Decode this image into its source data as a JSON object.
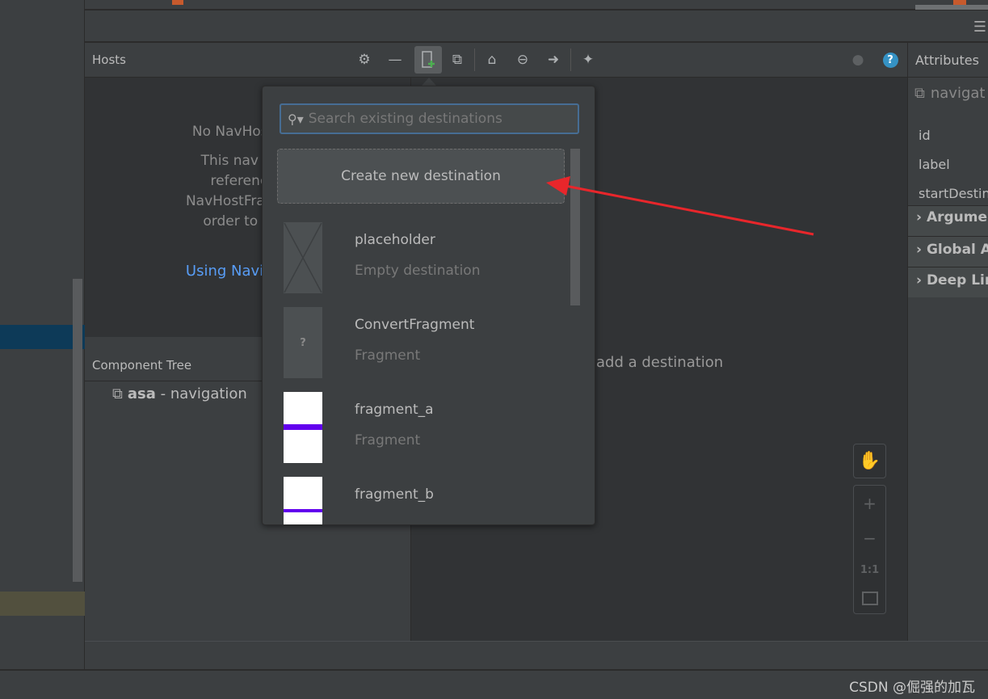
{
  "hosts_panel": {
    "title": "Hosts",
    "no_host": "No NavHostFrag",
    "message_lines": [
      "This nav grap",
      "referenced",
      "NavHostFragment",
      "order to be a"
    ],
    "link": "Using Navigation"
  },
  "component_tree": {
    "title": "Component Tree",
    "root_name": "asa",
    "root_suffix": " - navigation"
  },
  "attributes": {
    "title": "Attributes",
    "graph_label": "navigat",
    "fields": [
      "id",
      "label",
      "startDestina"
    ],
    "sections": [
      "Argume",
      "Global A",
      "Deep Lin"
    ]
  },
  "canvas": {
    "hint": "add a destination",
    "zoom_one_to_one": "1:1"
  },
  "popup": {
    "search_placeholder": "Search existing destinations",
    "create_label": "Create new destination",
    "items": [
      {
        "name": "placeholder",
        "type": "Empty destination",
        "thumb": "placeholder"
      },
      {
        "name": "ConvertFragment",
        "type": "Fragment",
        "thumb": "unknown"
      },
      {
        "name": "fragment_a",
        "type": "Fragment",
        "thumb": "layout"
      },
      {
        "name": "fragment_b",
        "type": "",
        "thumb": "layout"
      }
    ],
    "unknown_glyph": "?"
  },
  "watermark": "CSDN @倔强的加瓦",
  "colors": {
    "link": "#589df6",
    "annotation_arrow": "#e8262b",
    "accent_add": "#4caf50",
    "help": "#3592c4",
    "fragment_bar": "#6200ee"
  }
}
